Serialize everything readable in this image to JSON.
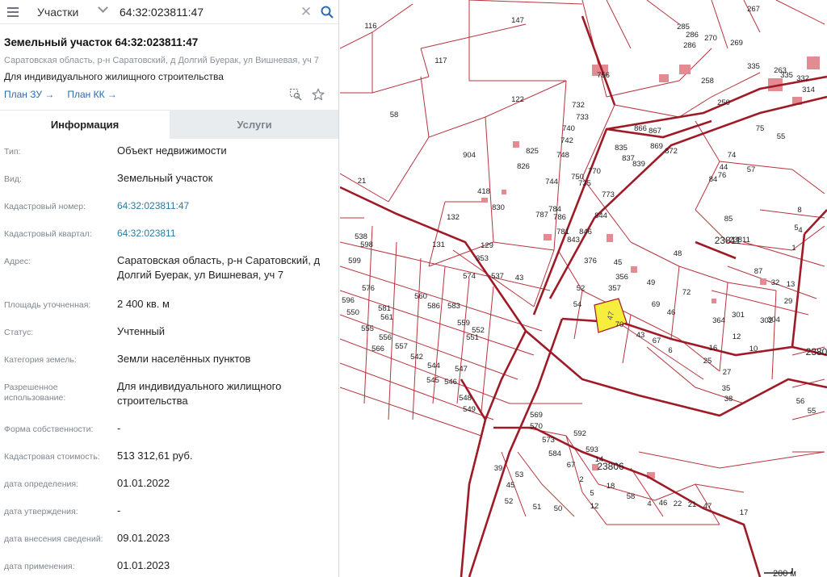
{
  "search": {
    "layer": "Участки",
    "query": "64:32:023811:47"
  },
  "card": {
    "title": "Земельный участок 64:32:023811:47",
    "address": "Саратовская область, р-н Саратовский, д Долгий Буерак, ул Вишневая, уч 7",
    "purpose": "Для индивидуального жилищного строительства",
    "link_plan_zu": "План ЗУ →",
    "link_plan_kk": "План КК →"
  },
  "tabs": {
    "info": "Информация",
    "services": "Услуги"
  },
  "fields": [
    {
      "label": "Тип:",
      "value": "Объект недвижимости"
    },
    {
      "label": "Вид:",
      "value": "Земельный участок"
    },
    {
      "label": "Кадастровый номер:",
      "value": "64:32:023811:47"
    },
    {
      "label": "Кадастровый квартал:",
      "value": "64:32:023811"
    },
    {
      "label": "Адрес:",
      "value": "Саратовская область, р-н Саратовский, д Долгий Буерак, ул Вишневая, уч 7"
    },
    {
      "label": "Площадь уточненная:",
      "value": "2 400 кв. м"
    },
    {
      "label": "Статус:",
      "value": "Учтенный"
    },
    {
      "label": "Категория земель:",
      "value": "Земли населённых пунктов"
    },
    {
      "label": "Разрешенное использование:",
      "value": "Для индивидуального жилищного строительства"
    },
    {
      "label": "Форма собственности:",
      "value": "-"
    },
    {
      "label": "Кадастровая стоимость:",
      "value": "513 312,61 руб."
    },
    {
      "label": "дата определения:",
      "value": "01.01.2022"
    },
    {
      "label": "дата утверждения:",
      "value": "-"
    },
    {
      "label": "дата внесения сведений:",
      "value": "09.01.2023"
    },
    {
      "label": "дата применения:",
      "value": "01.01.2023"
    }
  ],
  "map": {
    "selected_parcel": "47",
    "quarter_labels": [
      "23811",
      "23806",
      "2380"
    ],
    "scale": "200 м",
    "parcel_labels": [
      "116",
      "147",
      "117",
      "58",
      "122",
      "756",
      "21",
      "904",
      "132",
      "129",
      "131",
      "43",
      "418",
      "825",
      "826",
      "830",
      "732",
      "733",
      "740",
      "742",
      "748",
      "744",
      "735",
      "750",
      "770",
      "773",
      "784",
      "786",
      "787",
      "781",
      "843",
      "846",
      "844",
      "835",
      "837",
      "839",
      "869",
      "872",
      "866",
      "867",
      "285",
      "286",
      "270",
      "258",
      "269",
      "267",
      "263",
      "286",
      "335",
      "332",
      "314",
      "250",
      "335",
      "75",
      "74",
      "76",
      "55",
      "44",
      "84",
      "57",
      "85",
      "87",
      "13",
      "32",
      "29",
      "5",
      "1",
      "8",
      "4",
      "23811",
      "52",
      "54",
      "376",
      "45",
      "356",
      "357",
      "49",
      "69",
      "46",
      "72",
      "48",
      "43",
      "70",
      "67",
      "6",
      "16",
      "25",
      "27",
      "38",
      "35",
      "12",
      "10",
      "364",
      "301",
      "302",
      "304",
      "353",
      "574",
      "537",
      "538",
      "598",
      "599",
      "596",
      "576",
      "581",
      "561",
      "560",
      "586",
      "583",
      "559",
      "550",
      "555",
      "556",
      "557",
      "542",
      "544",
      "545",
      "546",
      "547",
      "548",
      "549",
      "551",
      "552",
      "566",
      "569",
      "570",
      "573",
      "584",
      "592",
      "593",
      "67",
      "2",
      "5",
      "12",
      "18",
      "39",
      "45",
      "53",
      "52",
      "51",
      "50",
      "58",
      "4",
      "46",
      "22",
      "21",
      "47",
      "17",
      "14",
      "56",
      "55",
      "44",
      "42",
      "41",
      "3",
      "23806",
      "21",
      "24"
    ],
    "colors": {
      "boundary": "#9e1a26",
      "line": "#b8333d",
      "selected": "#f7ed3c",
      "building": "#e48a93"
    }
  }
}
